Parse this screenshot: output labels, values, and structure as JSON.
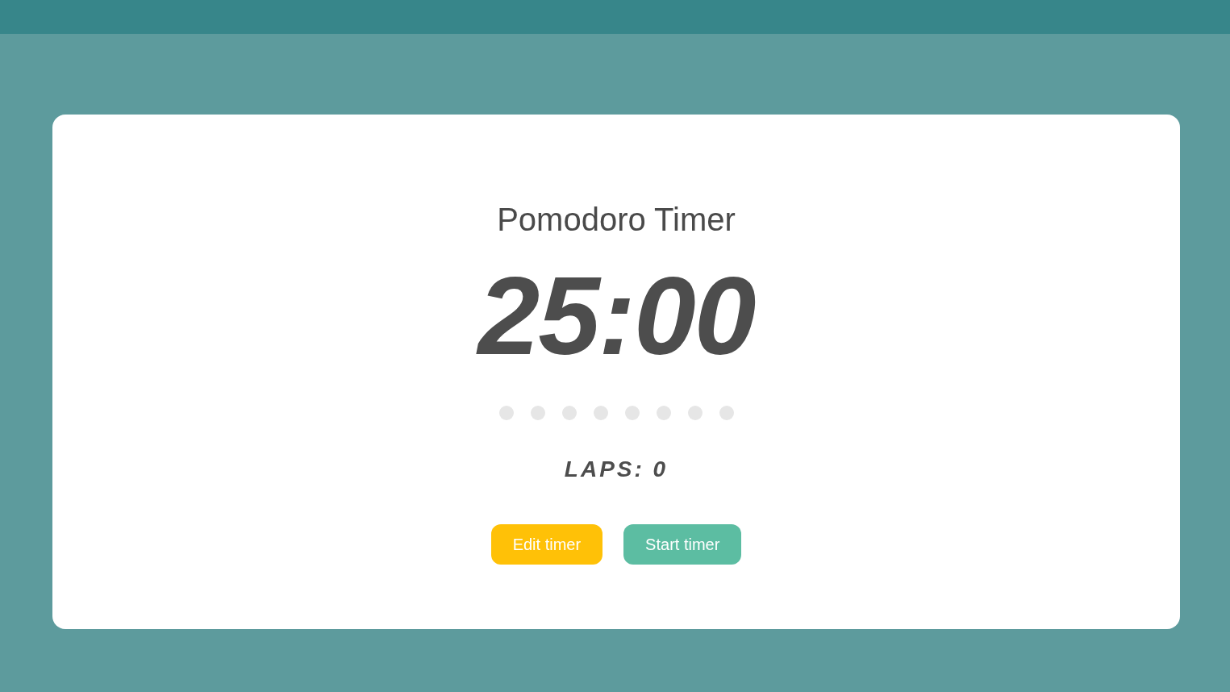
{
  "title": "Pomodoro Timer",
  "timer": {
    "display": "25:00"
  },
  "progress_dots": [
    {
      "filled": false
    },
    {
      "filled": false
    },
    {
      "filled": false
    },
    {
      "filled": false
    },
    {
      "filled": false
    },
    {
      "filled": false
    },
    {
      "filled": false
    },
    {
      "filled": false
    }
  ],
  "laps": "LAPS: 0",
  "buttons": [
    {
      "label": "Edit timer",
      "kind": "edit"
    },
    {
      "label": "Start timer",
      "kind": "start"
    }
  ]
}
